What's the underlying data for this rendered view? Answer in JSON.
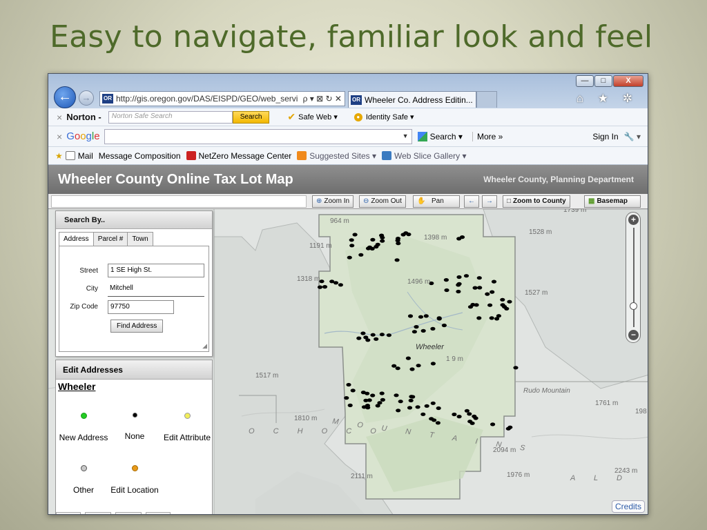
{
  "slide": {
    "title": "Easy to navigate, familiar look and feel"
  },
  "browser": {
    "window_buttons": {
      "minimize": "—",
      "maximize": "□",
      "close": "X"
    },
    "address": {
      "favicon": "OR",
      "url": "http://gis.oregon.gov/DAS/EISPD/GEO/web_servi",
      "icons": "ρ ▾ ⊠ ↻ ✕"
    },
    "tab": {
      "favicon": "OR",
      "title": "Wheeler Co. Address Editin...",
      "close": "✕"
    },
    "top_icons": "⌂ ★ ✲"
  },
  "norton": {
    "logo": "Norton -",
    "search_placeholder": "Norton Safe Search",
    "search_button": "Search",
    "safe_web": "Safe Web ▾",
    "identity_safe": "Identity Safe ▾"
  },
  "google": {
    "logo": "Google",
    "search": "Search ▾",
    "more": "More »",
    "sign_in": "Sign In"
  },
  "favorites": {
    "items": [
      {
        "label": "Mail",
        "color": "#8aa8d0"
      },
      {
        "label": "Message Composition",
        "color": ""
      },
      {
        "label": "NetZero Message Center",
        "color": "#cc2222"
      },
      {
        "label": "Suggested Sites ▾",
        "color": "#f08a1c"
      },
      {
        "label": "Web Slice Gallery ▾",
        "color": "#3a7ac0"
      }
    ]
  },
  "app": {
    "title": "Wheeler County Online Tax Lot Map",
    "department": "Wheeler County, Planning Department"
  },
  "toolbar": {
    "zoom_in": "Zoom In",
    "zoom_out": "Zoom Out",
    "pan": "Pan",
    "zoom_to_county": "Zoom to County",
    "basemap": "Basemap"
  },
  "search_panel": {
    "title": "Search By..",
    "tabs": [
      "Address",
      "Parcel #",
      "Town"
    ],
    "fields": {
      "street_label": "Street",
      "street_value": "1 SE High St.",
      "city_label": "City",
      "city_value": "Mitchell",
      "zip_label": "Zip Code",
      "zip_value": "97750"
    },
    "find_button": "Find Address"
  },
  "edit_panel": {
    "title": "Edit Addresses",
    "town": "Wheeler",
    "legend": [
      {
        "label": "New Address",
        "color": "#22cc22"
      },
      {
        "label": "None",
        "color": "#000000"
      },
      {
        "label": "Edit Attribute",
        "color": "#f2ee5a"
      },
      {
        "label": "Other",
        "color": "#c8c8c8"
      },
      {
        "label": "Edit Location",
        "color": "#e89a1a"
      }
    ]
  },
  "map": {
    "elevations": [
      "964 m",
      "1398 m",
      "1191 m",
      "1528 m",
      "1739 m",
      "1318 m",
      "1496 m",
      "1527 m",
      "1517 m",
      "1810 m",
      "1761 m",
      "198",
      "2094 m",
      "2111 m",
      "1976 m",
      "2243 m",
      "1 9 m"
    ],
    "place_labels": [
      "Wheeler",
      "Rudo Mountain"
    ],
    "region_text": [
      "O C H O C O",
      "M O U N T A I N S",
      "A  L  D"
    ],
    "credits": "Credits"
  }
}
